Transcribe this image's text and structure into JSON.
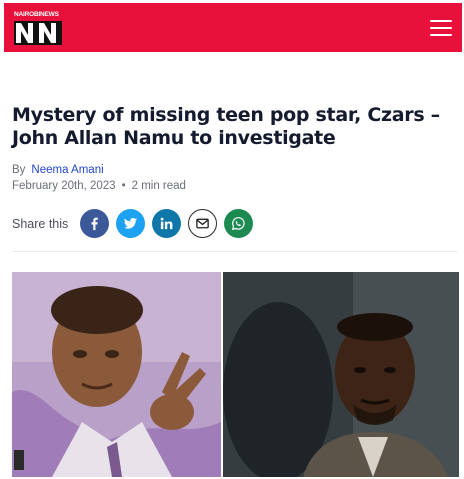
{
  "header": {
    "logo_text_top": "NAIROBI NEWS",
    "logo_text_main": "NN",
    "brand_color": "#e8113c",
    "menu_icon": "hamburger-menu-icon"
  },
  "article": {
    "title": "Mystery of missing teen pop star, Czars – John Allan Namu to investigate",
    "by_label": "By",
    "author": "Neema Amani",
    "date": "February 20th, 2023",
    "separator": "•",
    "read_time": "2 min read"
  },
  "share": {
    "label": "Share this",
    "buttons": [
      {
        "icon": "facebook-icon",
        "color": "#3b5998"
      },
      {
        "icon": "twitter-icon",
        "color": "#1da1f2"
      },
      {
        "icon": "linkedin-icon",
        "color": "#0e76a8"
      },
      {
        "icon": "email-icon",
        "color": "#ffffff"
      },
      {
        "icon": "whatsapp-icon",
        "color": "#1d8a52"
      }
    ]
  },
  "hero_image": {
    "left": "photo-of-young-man-in-purple-suit",
    "right": "photo-of-man-portrait"
  }
}
